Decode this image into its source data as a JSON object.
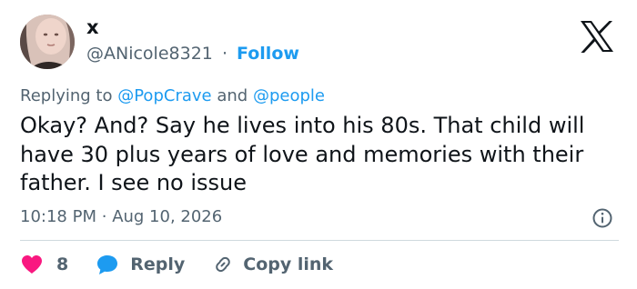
{
  "user": {
    "display_name": "x",
    "handle": "@ANicole8321",
    "separator": "·",
    "follow_label": "Follow"
  },
  "reply_context": {
    "prefix": "Replying to",
    "mention_1": "@PopCrave",
    "conjunction": "and",
    "mention_2": "@people"
  },
  "tweet": {
    "text": "Okay? And? Say he lives into his 80s. That child will have 30 plus years of love and memories with their father. I see no issue"
  },
  "meta": {
    "time": "10:18 PM",
    "separator": "·",
    "date": "Aug 10, 2026"
  },
  "actions": {
    "like_count": "8",
    "reply_label": "Reply",
    "copy_link_label": "Copy link"
  },
  "colors": {
    "accent": "#1d9bf0",
    "like": "#f91880",
    "secondary_text": "#536471",
    "primary_text": "#0f1419",
    "divider": "#cfd9de"
  },
  "icons": {
    "brand": "x-logo-icon",
    "info": "info-icon",
    "like": "heart-icon",
    "reply": "speech-bubble-icon",
    "copy": "link-icon"
  }
}
